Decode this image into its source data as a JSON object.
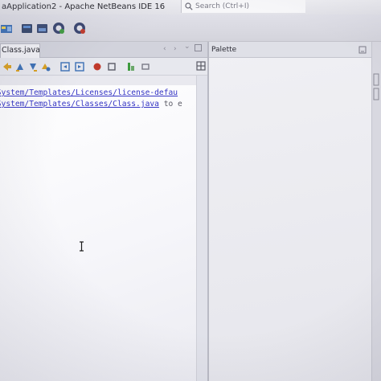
{
  "window": {
    "title": "aApplication2 - Apache NetBeans IDE 16"
  },
  "search": {
    "placeholder": "Search (Ctrl+I)"
  },
  "toolbar": {
    "icons": [
      "new-project-icon",
      "new-file-icon",
      "open-project-icon",
      "save-all-icon",
      "build-icon",
      "clean-build-icon"
    ]
  },
  "editor": {
    "tab_label": "Class.java",
    "tab_close": "✕",
    "nav_left": "‹",
    "nav_right": "›",
    "nav_down": "⌄",
    "lines": [
      {
        "link": "eSystem/Templates/Licenses/license-defau",
        "tail": ""
      },
      {
        "link": "eSystem/Templates/Classes/Class.java",
        "tail": "to e"
      }
    ]
  },
  "palette": {
    "title": "Palette"
  },
  "colors": {
    "link": "#3434c4",
    "accent_red": "#c0392b",
    "accent_green": "#3f9b3f",
    "netbeans_blue": "#2f6db3"
  }
}
